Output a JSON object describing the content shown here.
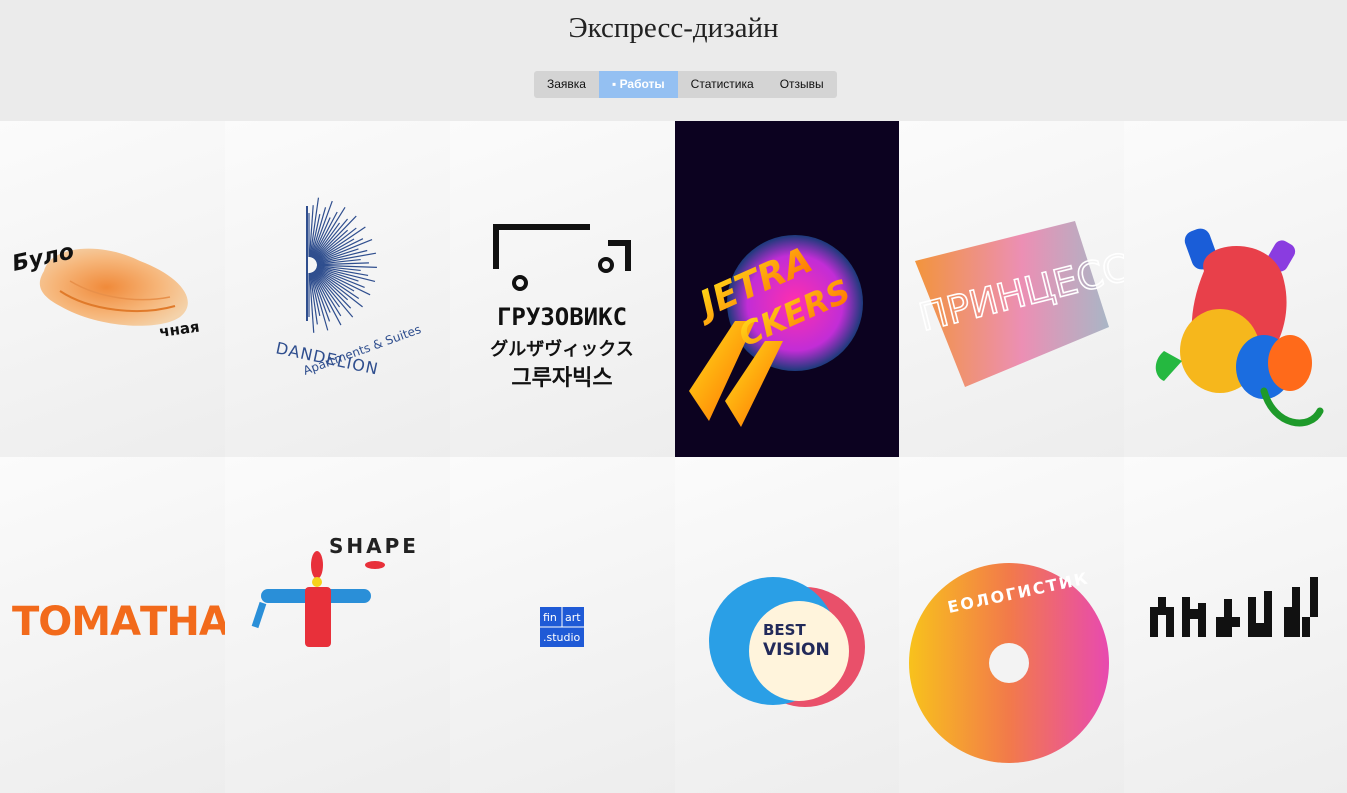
{
  "header": {
    "title": "Экспресс-дизайн"
  },
  "tabs": [
    {
      "label": "Заявка"
    },
    {
      "label": "Работы"
    },
    {
      "label": "Статистика"
    },
    {
      "label": "Отзывы"
    }
  ],
  "works": {
    "bulochnaya": {
      "top": "Було",
      "bottom": "чная"
    },
    "dandelion": {
      "name": "DANDELION",
      "tagline": "Apartments & Suites"
    },
    "gruzoviks": {
      "ru": "ГРУЗОВИКС",
      "jp": "グルザヴィックス",
      "kr": "그루자빅스"
    },
    "jetrackers": {
      "line1": "JETRA",
      "line2": "CKERS"
    },
    "princess": {
      "text": "ПРИНЦЕССЫ"
    },
    "tomata": {
      "text": "ТОМАТНА"
    },
    "shape": {
      "text": "SHAPE"
    },
    "finart": {
      "line1": "fin",
      "line2": "art",
      "line3": ".studio"
    },
    "bestvision": {
      "line1": "BEST",
      "line2": "VISION"
    },
    "geologistics": {
      "text": "ЕОЛОГИСТИК"
    }
  }
}
